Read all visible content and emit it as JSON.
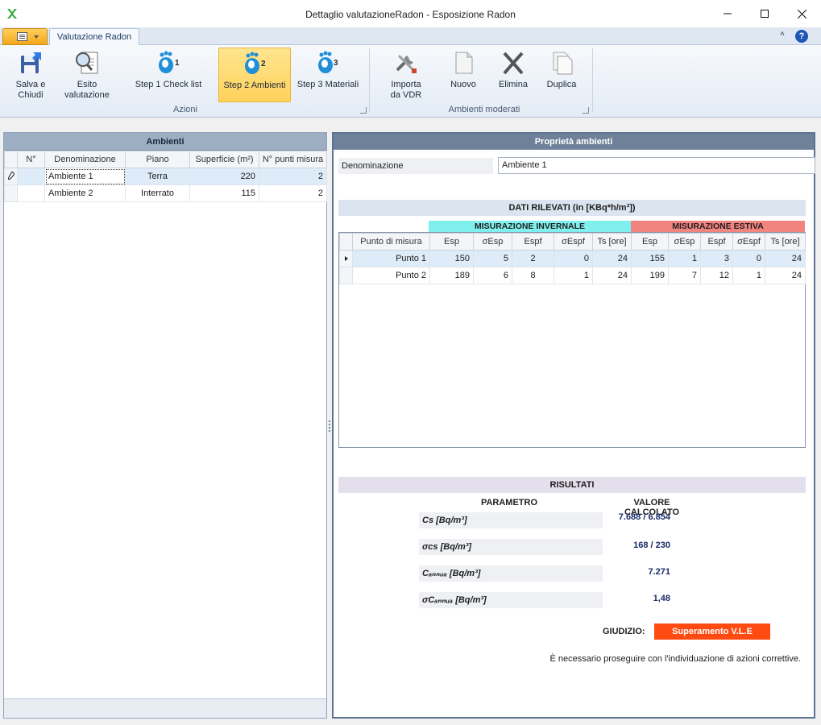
{
  "window": {
    "title": "Dettaglio valutazioneRadon - Esposizione Radon"
  },
  "ribbon": {
    "tab_label": "Valutazione Radon",
    "buttons": {
      "salva": "Salva e Chiudi",
      "esito": "Esito valutazione",
      "step1": "Step 1 Check list",
      "step2": "Step 2 Ambienti",
      "step3": "Step 3  Materiali",
      "importa": "Importa da VDR",
      "nuovo": "Nuovo",
      "elimina": "Elimina",
      "duplica": "Duplica"
    },
    "step_numbers": {
      "step1": "1",
      "step2": "2",
      "step3": "3"
    },
    "groups": {
      "azioni": "Azioni",
      "ambienti_moderati": "Ambienti moderati"
    }
  },
  "ambienti": {
    "title": "Ambienti",
    "headers": [
      "N°",
      "Denominazione",
      "Piano",
      "Superficie (m²)",
      "N° punti misura"
    ],
    "rows": [
      {
        "n": "",
        "denominazione": "Ambiente 1",
        "piano": "Terra",
        "superficie": "220",
        "punti": "2"
      },
      {
        "n": "",
        "denominazione": "Ambiente 2",
        "piano": "Interrato",
        "superficie": "115",
        "punti": "2"
      }
    ]
  },
  "proprieta": {
    "title": "Proprietà ambienti",
    "denominazione_label": "Denominazione",
    "denominazione_value": "Ambiente 1",
    "dati_title": "DATI RILEVATI  (in  [KBq*h/m³])",
    "mis_invernale": "MISURAZIONE INVERNALE",
    "mis_estiva": "MISURAZIONE ESTIVA",
    "dati_headers": [
      "Punto di misura",
      "Esp",
      "σEsp",
      "Espf",
      "σEspf",
      "Ts [ore]",
      "Esp",
      "σEsp",
      "Espf",
      "σEspf",
      "Ts [ore]"
    ],
    "dati_rows": [
      [
        "Punto 1",
        "150",
        "5",
        "2",
        "0",
        "24",
        "155",
        "1",
        "3",
        "0",
        "24"
      ],
      [
        "Punto 2",
        "189",
        "6",
        "8",
        "1",
        "24",
        "199",
        "7",
        "12",
        "1",
        "24"
      ]
    ]
  },
  "risultati": {
    "title": "RISULTATI",
    "parametro_header": "PARAMETRO",
    "valore_header": "VALORE CALCOLATO",
    "items": [
      {
        "label": "Cs [Bq/m³]",
        "value": "7.688 / 6.854"
      },
      {
        "label": "σcs [Bq/m³]",
        "value": "168 / 230"
      },
      {
        "label": "Cₐₙₙᵤₐ [Bq/m³]",
        "value": "7.271"
      },
      {
        "label": "σCₐₙₙᵤₐ [Bq/m³]",
        "value": "1,48"
      }
    ],
    "giudizio_label": "GIUDIZIO:",
    "giudizio_value": "Superamento V.L.E",
    "nota": "È necessario proseguire con l'individuazione di azioni correttive."
  },
  "colors": {
    "invernale": "#7ff0ee",
    "estiva": "#f28480",
    "giudizio": "#ff4a12",
    "active_button": "#ffd25a"
  }
}
